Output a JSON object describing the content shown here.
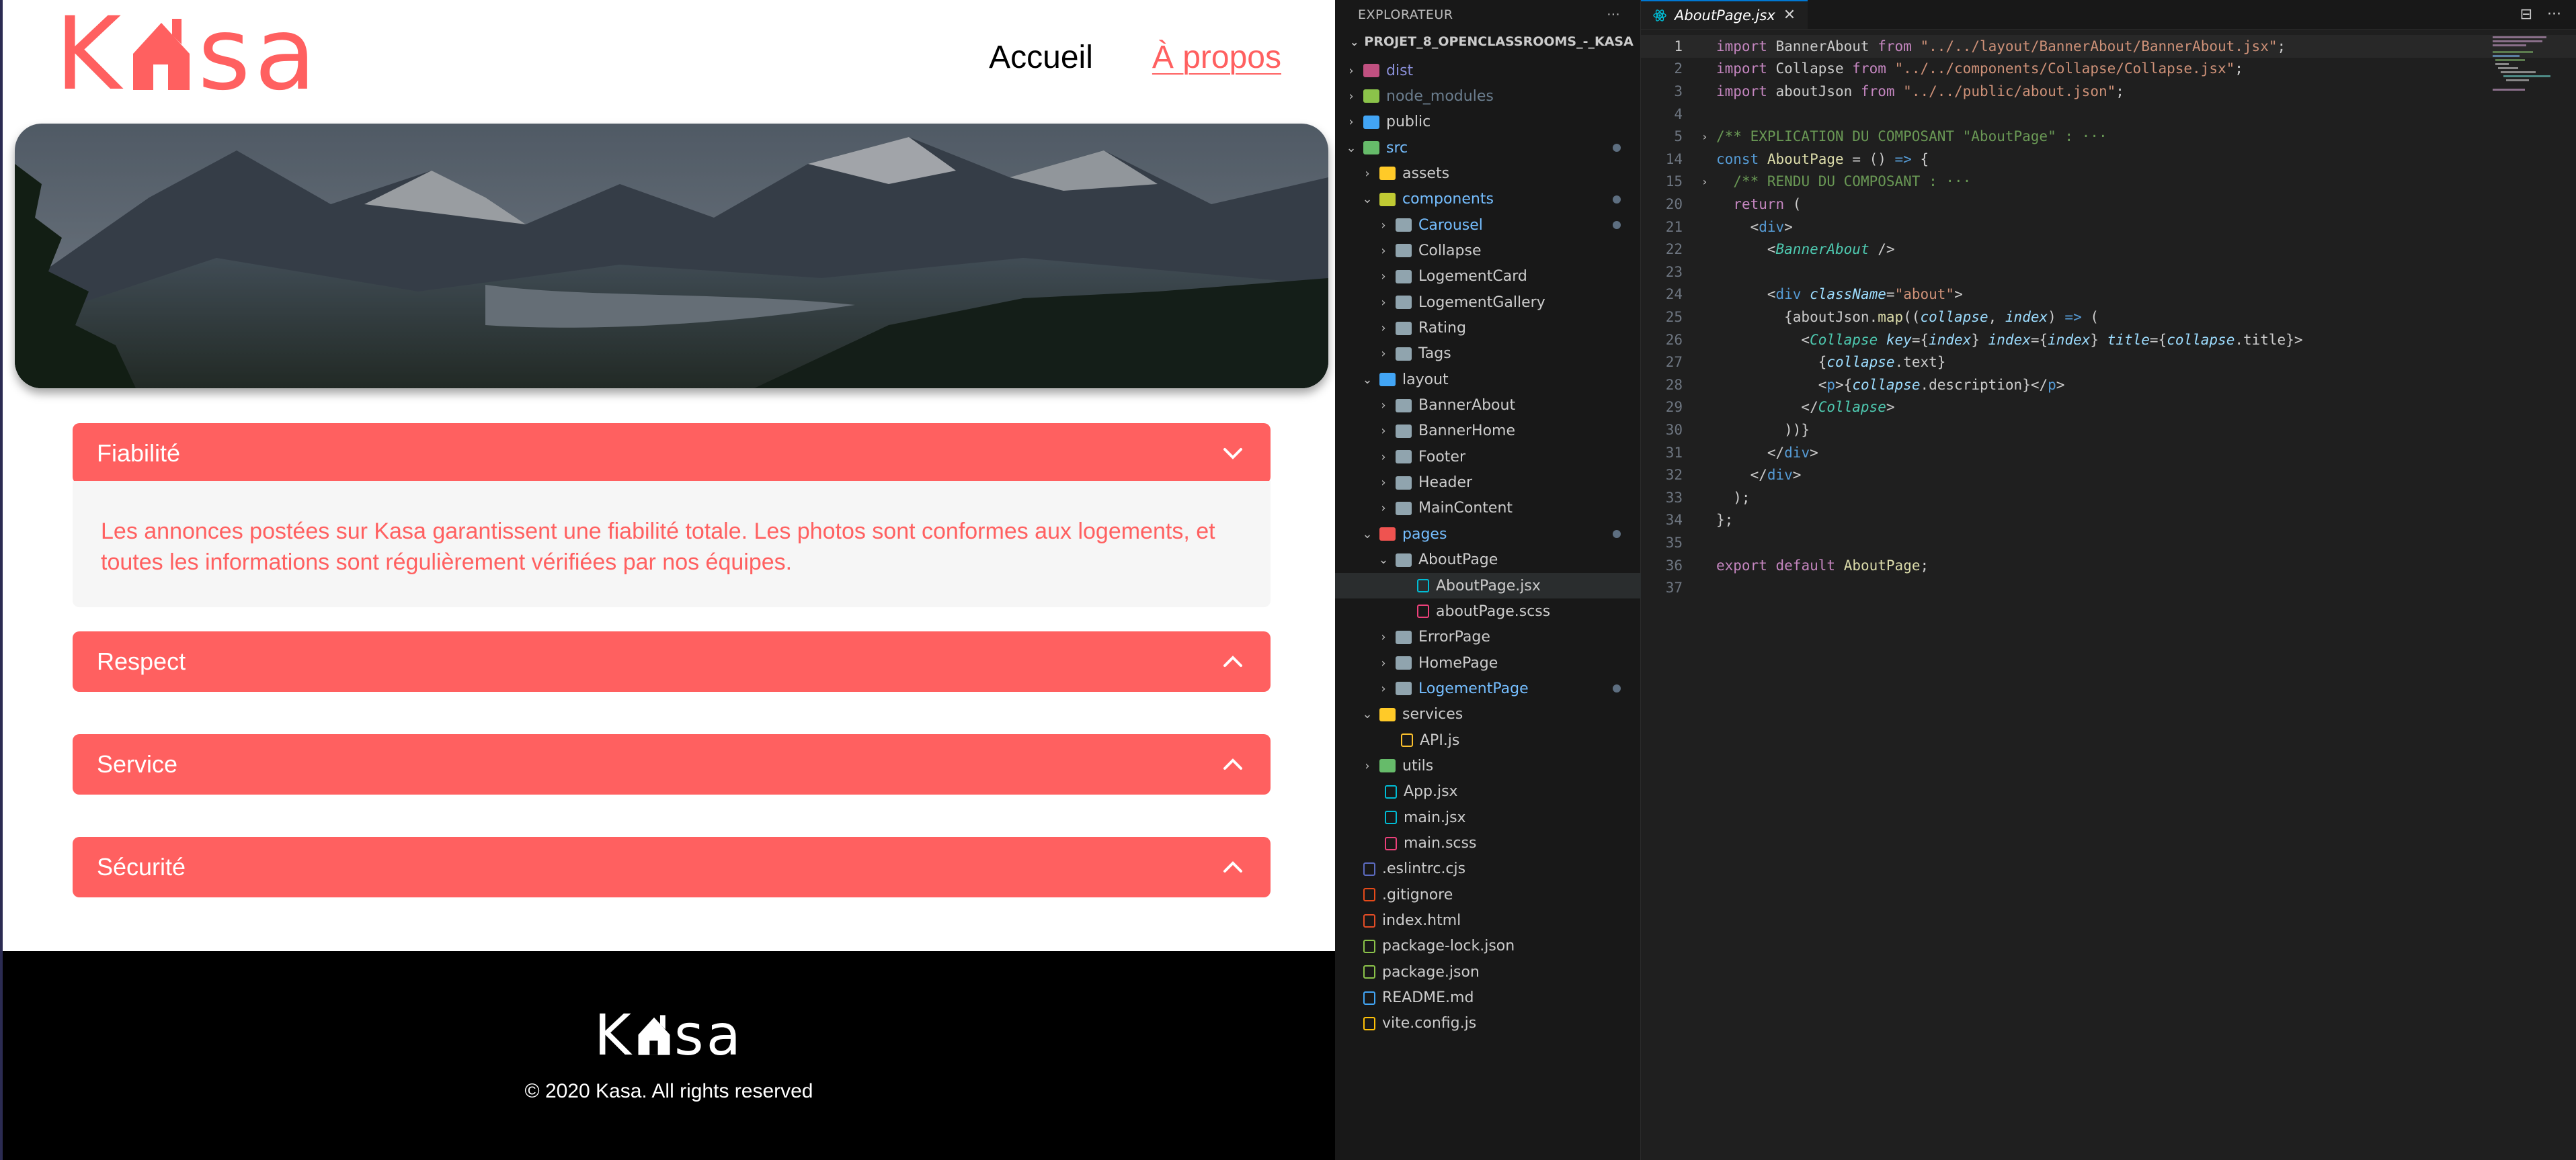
{
  "site": {
    "logo_text_left": "K",
    "logo_text_right": "sa",
    "nav": {
      "home": "Accueil",
      "about": "À propos"
    },
    "collapses": [
      {
        "title": "Fiabilité",
        "open": true,
        "text": "Les annonces postées sur Kasa garantissent une fiabilité totale. Les photos sont conformes aux logements, et toutes les informations sont régulièrement vérifiées par nos équipes."
      },
      {
        "title": "Respect",
        "open": false
      },
      {
        "title": "Service",
        "open": false
      },
      {
        "title": "Sécurité",
        "open": false
      }
    ],
    "footer": {
      "logo_left": "K",
      "logo_right": "sa",
      "copyright": "© 2020 Kasa. All rights reserved"
    },
    "colors": {
      "brand": "#ff6060",
      "footer_bg": "#000000"
    }
  },
  "explorer": {
    "title": "EXPLORATEUR",
    "more": "···",
    "project": "PROJET_8_OPENCLASSROOMS_-_KASA",
    "items": [
      {
        "label": "dist",
        "type": "folder",
        "depth": 0,
        "arrow": "right",
        "color": "#8a8fd8",
        "icon": "#c05080"
      },
      {
        "label": "node_modules",
        "type": "folder",
        "depth": 0,
        "arrow": "right",
        "color": "#6b7e8f",
        "icon": "#8bc34a"
      },
      {
        "label": "public",
        "type": "folder",
        "depth": 0,
        "arrow": "right",
        "color": "#cccccc",
        "icon": "#42a5f5"
      },
      {
        "label": "src",
        "type": "folder",
        "depth": 0,
        "arrow": "down",
        "color": "#75beff",
        "icon": "#66bb6a",
        "dot": true
      },
      {
        "label": "assets",
        "type": "folder",
        "depth": 1,
        "arrow": "right",
        "color": "#cccccc",
        "icon": "#ffca28"
      },
      {
        "label": "components",
        "type": "folder",
        "depth": 1,
        "arrow": "down",
        "color": "#75beff",
        "icon": "#c0ca33",
        "dot": true
      },
      {
        "label": "Carousel",
        "type": "folder",
        "depth": 2,
        "arrow": "right",
        "color": "#75beff",
        "icon": "#90a4ae",
        "dot": true
      },
      {
        "label": "Collapse",
        "type": "folder",
        "depth": 2,
        "arrow": "right",
        "color": "#cccccc",
        "icon": "#90a4ae"
      },
      {
        "label": "LogementCard",
        "type": "folder",
        "depth": 2,
        "arrow": "right",
        "color": "#cccccc",
        "icon": "#90a4ae"
      },
      {
        "label": "LogementGallery",
        "type": "folder",
        "depth": 2,
        "arrow": "right",
        "color": "#cccccc",
        "icon": "#90a4ae"
      },
      {
        "label": "Rating",
        "type": "folder",
        "depth": 2,
        "arrow": "right",
        "color": "#cccccc",
        "icon": "#90a4ae"
      },
      {
        "label": "Tags",
        "type": "folder",
        "depth": 2,
        "arrow": "right",
        "color": "#cccccc",
        "icon": "#90a4ae"
      },
      {
        "label": "layout",
        "type": "folder",
        "depth": 1,
        "arrow": "down",
        "color": "#cccccc",
        "icon": "#42a5f5"
      },
      {
        "label": "BannerAbout",
        "type": "folder",
        "depth": 2,
        "arrow": "right",
        "color": "#cccccc",
        "icon": "#90a4ae"
      },
      {
        "label": "BannerHome",
        "type": "folder",
        "depth": 2,
        "arrow": "right",
        "color": "#cccccc",
        "icon": "#90a4ae"
      },
      {
        "label": "Footer",
        "type": "folder",
        "depth": 2,
        "arrow": "right",
        "color": "#cccccc",
        "icon": "#90a4ae"
      },
      {
        "label": "Header",
        "type": "folder",
        "depth": 2,
        "arrow": "right",
        "color": "#cccccc",
        "icon": "#90a4ae"
      },
      {
        "label": "MainContent",
        "type": "folder",
        "depth": 2,
        "arrow": "right",
        "color": "#cccccc",
        "icon": "#90a4ae"
      },
      {
        "label": "pages",
        "type": "folder",
        "depth": 1,
        "arrow": "down",
        "color": "#75beff",
        "icon": "#ef5350",
        "dot": true
      },
      {
        "label": "AboutPage",
        "type": "folder",
        "depth": 2,
        "arrow": "down",
        "color": "#cccccc",
        "icon": "#90a4ae"
      },
      {
        "label": "AboutPage.jsx",
        "type": "file",
        "depth": 3,
        "color": "#cccccc",
        "icon": "#00bcd4",
        "selected": true
      },
      {
        "label": "aboutPage.scss",
        "type": "file",
        "depth": 3,
        "color": "#cccccc",
        "icon": "#ec407a"
      },
      {
        "label": "ErrorPage",
        "type": "folder",
        "depth": 2,
        "arrow": "right",
        "color": "#cccccc",
        "icon": "#90a4ae"
      },
      {
        "label": "HomePage",
        "type": "folder",
        "depth": 2,
        "arrow": "right",
        "color": "#cccccc",
        "icon": "#90a4ae"
      },
      {
        "label": "LogementPage",
        "type": "folder",
        "depth": 2,
        "arrow": "right",
        "color": "#75beff",
        "icon": "#90a4ae",
        "dot": true
      },
      {
        "label": "services",
        "type": "folder",
        "depth": 1,
        "arrow": "down",
        "color": "#cccccc",
        "icon": "#ffca28"
      },
      {
        "label": "API.js",
        "type": "file",
        "depth": 2,
        "color": "#cccccc",
        "icon": "#fbc02d"
      },
      {
        "label": "utils",
        "type": "folder",
        "depth": 1,
        "arrow": "right",
        "color": "#cccccc",
        "icon": "#66bb6a"
      },
      {
        "label": "App.jsx",
        "type": "file",
        "depth": 1,
        "color": "#cccccc",
        "icon": "#00bcd4"
      },
      {
        "label": "main.jsx",
        "type": "file",
        "depth": 1,
        "color": "#cccccc",
        "icon": "#00bcd4"
      },
      {
        "label": "main.scss",
        "type": "file",
        "depth": 1,
        "color": "#cccccc",
        "icon": "#ec407a"
      },
      {
        "label": ".eslintrc.cjs",
        "type": "file",
        "depth": 0,
        "color": "#cccccc",
        "icon": "#5c6bc0"
      },
      {
        "label": ".gitignore",
        "type": "file",
        "depth": 0,
        "color": "#cccccc",
        "icon": "#e64a19"
      },
      {
        "label": "index.html",
        "type": "file",
        "depth": 0,
        "color": "#cccccc",
        "icon": "#e44d26"
      },
      {
        "label": "package-lock.json",
        "type": "file",
        "depth": 0,
        "color": "#cccccc",
        "icon": "#8bc34a"
      },
      {
        "label": "package.json",
        "type": "file",
        "depth": 0,
        "color": "#cccccc",
        "icon": "#8bc34a"
      },
      {
        "label": "README.md",
        "type": "file",
        "depth": 0,
        "color": "#cccccc",
        "icon": "#42a5f5"
      },
      {
        "label": "vite.config.js",
        "type": "file",
        "depth": 0,
        "color": "#cccccc",
        "icon": "#ffc107"
      }
    ]
  },
  "editor": {
    "tab": {
      "label": "AboutPage.jsx",
      "close": "✕"
    },
    "actions": [
      "⊟",
      "···"
    ],
    "lines": [
      {
        "n": "1",
        "current": true,
        "tokens": [
          [
            "kw",
            "import"
          ],
          [
            "src",
            " BannerAbout "
          ],
          [
            "kw",
            "from"
          ],
          [
            "src",
            " "
          ],
          [
            "str",
            "\"../../layout/BannerAbout/BannerAbout.jsx\""
          ],
          [
            "src",
            ";"
          ]
        ]
      },
      {
        "n": "2",
        "tokens": [
          [
            "kw",
            "import"
          ],
          [
            "src",
            " Collapse "
          ],
          [
            "kw",
            "from"
          ],
          [
            "src",
            " "
          ],
          [
            "str",
            "\"../../components/Collapse/Collapse.jsx\""
          ],
          [
            "src",
            ";"
          ]
        ]
      },
      {
        "n": "3",
        "tokens": [
          [
            "kw",
            "import"
          ],
          [
            "src",
            " aboutJson "
          ],
          [
            "kw",
            "from"
          ],
          [
            "src",
            " "
          ],
          [
            "str",
            "\"../../public/about.json\""
          ],
          [
            "src",
            ";"
          ]
        ]
      },
      {
        "n": "4",
        "tokens": []
      },
      {
        "n": "5",
        "fold": "›",
        "tokens": [
          [
            "cmt",
            "/** EXPLICATION DU COMPOSANT \"AboutPage\" : ···"
          ]
        ]
      },
      {
        "n": "14",
        "tokens": [
          [
            "def",
            "const"
          ],
          [
            "src",
            " "
          ],
          [
            "fn",
            "AboutPage"
          ],
          [
            "src",
            " = () "
          ],
          [
            "def",
            "=>"
          ],
          [
            "src",
            " {"
          ]
        ]
      },
      {
        "n": "15",
        "fold": "›",
        "tokens": [
          [
            "src",
            "  "
          ],
          [
            "cmt",
            "/** RENDU DU COMPOSANT : ···"
          ]
        ]
      },
      {
        "n": "20",
        "tokens": [
          [
            "src",
            "  "
          ],
          [
            "kw",
            "return"
          ],
          [
            "src",
            " ("
          ]
        ]
      },
      {
        "n": "21",
        "tokens": [
          [
            "src",
            "    <"
          ],
          [
            "def",
            "div"
          ],
          [
            "src",
            ">"
          ]
        ]
      },
      {
        "n": "22",
        "tokens": [
          [
            "src",
            "      <"
          ],
          [
            "tag",
            "BannerAbout"
          ],
          [
            "src",
            " />"
          ]
        ]
      },
      {
        "n": "23",
        "tokens": []
      },
      {
        "n": "24",
        "tokens": [
          [
            "src",
            "      <"
          ],
          [
            "def",
            "div"
          ],
          [
            "src",
            " "
          ],
          [
            "attr",
            "className"
          ],
          [
            "src",
            "="
          ],
          [
            "str",
            "\"about\""
          ],
          [
            "src",
            ">"
          ]
        ]
      },
      {
        "n": "25",
        "tokens": [
          [
            "src",
            "        {aboutJson."
          ],
          [
            "fn",
            "map"
          ],
          [
            "src",
            "(("
          ],
          [
            "attr",
            "collapse"
          ],
          [
            "src",
            ", "
          ],
          [
            "attr",
            "index"
          ],
          [
            "src",
            ") "
          ],
          [
            "def",
            "=>"
          ],
          [
            "src",
            " ("
          ]
        ]
      },
      {
        "n": "26",
        "tokens": [
          [
            "src",
            "          <"
          ],
          [
            "tag",
            "Collapse"
          ],
          [
            "src",
            " "
          ],
          [
            "attr",
            "key"
          ],
          [
            "src",
            "={"
          ],
          [
            "attr",
            "index"
          ],
          [
            "src",
            "} "
          ],
          [
            "attr",
            "index"
          ],
          [
            "src",
            "={"
          ],
          [
            "attr",
            "index"
          ],
          [
            "src",
            "} "
          ],
          [
            "attr",
            "title"
          ],
          [
            "src",
            "={"
          ],
          [
            "attr",
            "collapse"
          ],
          [
            "src",
            ".title}>"
          ]
        ]
      },
      {
        "n": "27",
        "tokens": [
          [
            "src",
            "            {"
          ],
          [
            "attr",
            "collapse"
          ],
          [
            "src",
            ".text}"
          ]
        ]
      },
      {
        "n": "28",
        "tokens": [
          [
            "src",
            "            <"
          ],
          [
            "def",
            "p"
          ],
          [
            "src",
            ">{"
          ],
          [
            "attr",
            "collapse"
          ],
          [
            "src",
            ".description}</"
          ],
          [
            "def",
            "p"
          ],
          [
            "src",
            ">"
          ]
        ]
      },
      {
        "n": "29",
        "tokens": [
          [
            "src",
            "          </"
          ],
          [
            "tag",
            "Collapse"
          ],
          [
            "src",
            ">"
          ]
        ]
      },
      {
        "n": "30",
        "tokens": [
          [
            "src",
            "        ))}"
          ]
        ]
      },
      {
        "n": "31",
        "tokens": [
          [
            "src",
            "      </"
          ],
          [
            "def",
            "div"
          ],
          [
            "src",
            ">"
          ]
        ]
      },
      {
        "n": "32",
        "tokens": [
          [
            "src",
            "    </"
          ],
          [
            "def",
            "div"
          ],
          [
            "src",
            ">"
          ]
        ]
      },
      {
        "n": "33",
        "tokens": [
          [
            "src",
            "  );"
          ]
        ]
      },
      {
        "n": "34",
        "tokens": [
          [
            "src",
            "};"
          ]
        ]
      },
      {
        "n": "35",
        "tokens": []
      },
      {
        "n": "36",
        "tokens": [
          [
            "kw",
            "export"
          ],
          [
            "src",
            " "
          ],
          [
            "kw",
            "default"
          ],
          [
            "src",
            " "
          ],
          [
            "fn",
            "AboutPage"
          ],
          [
            "src",
            ";"
          ]
        ]
      },
      {
        "n": "37",
        "tokens": []
      }
    ]
  }
}
